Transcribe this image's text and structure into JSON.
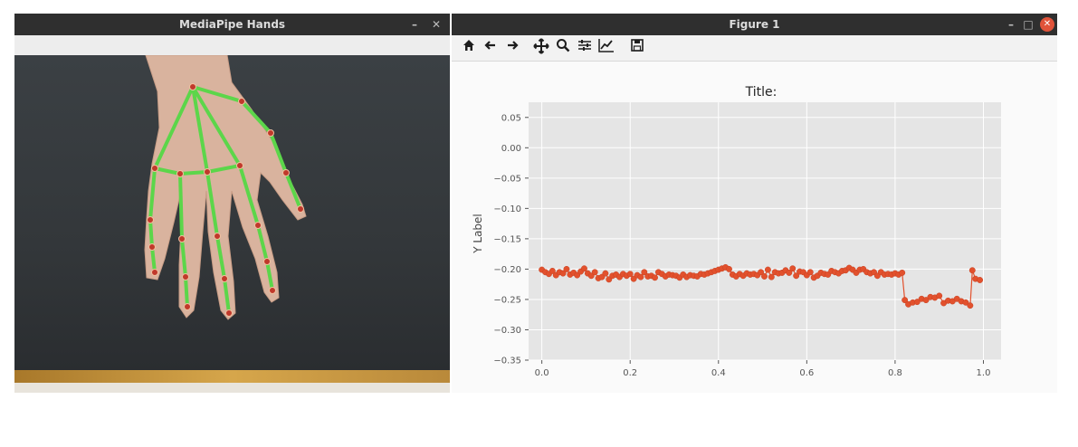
{
  "left_window": {
    "title": "MediaPipe Hands",
    "minimize_glyph": "–",
    "close_glyph": "✕"
  },
  "right_window": {
    "title": "Figure 1",
    "minimize_glyph": "–",
    "maximize_glyph": "□",
    "close_glyph": "✕"
  },
  "toolbar": {
    "icons": [
      "home-icon",
      "back-arrow-icon",
      "forward-arrow-icon",
      "pan-icon",
      "zoom-icon",
      "configure-subplots-icon",
      "edit-axis-icon",
      "save-icon"
    ]
  },
  "colors": {
    "titlebar": "#2f2f2f",
    "landmark_line": "#5cd64a",
    "landmark_point": "#c0392b",
    "plot_line": "#e2512d",
    "plot_bg": "#e5e5e5"
  },
  "chart_data": {
    "type": "line",
    "title": "Title:",
    "xlabel": "",
    "ylabel": "Y Label",
    "xlim": [
      -0.03,
      1.04
    ],
    "ylim": [
      -0.35,
      0.075
    ],
    "xticks": [
      "0.0",
      "0.2",
      "0.4",
      "0.6",
      "0.8",
      "1.0"
    ],
    "yticks": [
      "0.05",
      "0.00",
      "−0.05",
      "−0.10",
      "−0.15",
      "−0.20",
      "−0.25",
      "−0.30",
      "−0.35"
    ],
    "grid": true,
    "series": [
      {
        "x": [
          0.0,
          0.008,
          0.016,
          0.024,
          0.032,
          0.04,
          0.048,
          0.056,
          0.064,
          0.072,
          0.08,
          0.088,
          0.096,
          0.104,
          0.112,
          0.12,
          0.128,
          0.136,
          0.144,
          0.152,
          0.16,
          0.168,
          0.176,
          0.184,
          0.192,
          0.2,
          0.208,
          0.216,
          0.224,
          0.232,
          0.24,
          0.248,
          0.256,
          0.264,
          0.272,
          0.28,
          0.288,
          0.296,
          0.304,
          0.312,
          0.32,
          0.328,
          0.336,
          0.344,
          0.352,
          0.36,
          0.368,
          0.376,
          0.384,
          0.392,
          0.4,
          0.408,
          0.416,
          0.424,
          0.432,
          0.44,
          0.448,
          0.456,
          0.464,
          0.472,
          0.48,
          0.488,
          0.496,
          0.504,
          0.512,
          0.52,
          0.528,
          0.536,
          0.544,
          0.552,
          0.56,
          0.568,
          0.576,
          0.584,
          0.592,
          0.6,
          0.608,
          0.616,
          0.624,
          0.632,
          0.64,
          0.648,
          0.656,
          0.664,
          0.672,
          0.68,
          0.688,
          0.696,
          0.704,
          0.712,
          0.72,
          0.728,
          0.736,
          0.744,
          0.752,
          0.76,
          0.768,
          0.776,
          0.784,
          0.792,
          0.8,
          0.808,
          0.816,
          0.822,
          0.83,
          0.84,
          0.85,
          0.86,
          0.87,
          0.88,
          0.89,
          0.9,
          0.91,
          0.92,
          0.93,
          0.94,
          0.95,
          0.96,
          0.97,
          0.975,
          0.982,
          0.992
        ],
        "y": [
          -0.201,
          -0.205,
          -0.208,
          -0.203,
          -0.21,
          -0.205,
          -0.207,
          -0.2,
          -0.209,
          -0.206,
          -0.21,
          -0.204,
          -0.199,
          -0.207,
          -0.211,
          -0.205,
          -0.215,
          -0.213,
          -0.207,
          -0.217,
          -0.211,
          -0.209,
          -0.213,
          -0.208,
          -0.211,
          -0.208,
          -0.216,
          -0.21,
          -0.213,
          -0.205,
          -0.212,
          -0.211,
          -0.214,
          -0.205,
          -0.208,
          -0.212,
          -0.209,
          -0.21,
          -0.211,
          -0.214,
          -0.209,
          -0.213,
          -0.21,
          -0.211,
          -0.212,
          -0.208,
          -0.209,
          -0.207,
          -0.205,
          -0.203,
          -0.201,
          -0.199,
          -0.197,
          -0.2,
          -0.209,
          -0.212,
          -0.208,
          -0.211,
          -0.207,
          -0.209,
          -0.208,
          -0.21,
          -0.205,
          -0.212,
          -0.201,
          -0.213,
          -0.205,
          -0.207,
          -0.206,
          -0.202,
          -0.206,
          -0.199,
          -0.211,
          -0.204,
          -0.205,
          -0.21,
          -0.205,
          -0.214,
          -0.211,
          -0.206,
          -0.208,
          -0.209,
          -0.203,
          -0.205,
          -0.207,
          -0.203,
          -0.202,
          -0.198,
          -0.201,
          -0.206,
          -0.201,
          -0.2,
          -0.205,
          -0.207,
          -0.205,
          -0.211,
          -0.205,
          -0.209,
          -0.208,
          -0.209,
          -0.207,
          -0.209,
          -0.206,
          -0.251,
          -0.258,
          -0.255,
          -0.254,
          -0.249,
          -0.251,
          -0.246,
          -0.247,
          -0.244,
          -0.256,
          -0.252,
          -0.253,
          -0.249,
          -0.253,
          -0.255,
          -0.26,
          -0.202,
          -0.216,
          -0.218
        ]
      }
    ]
  }
}
